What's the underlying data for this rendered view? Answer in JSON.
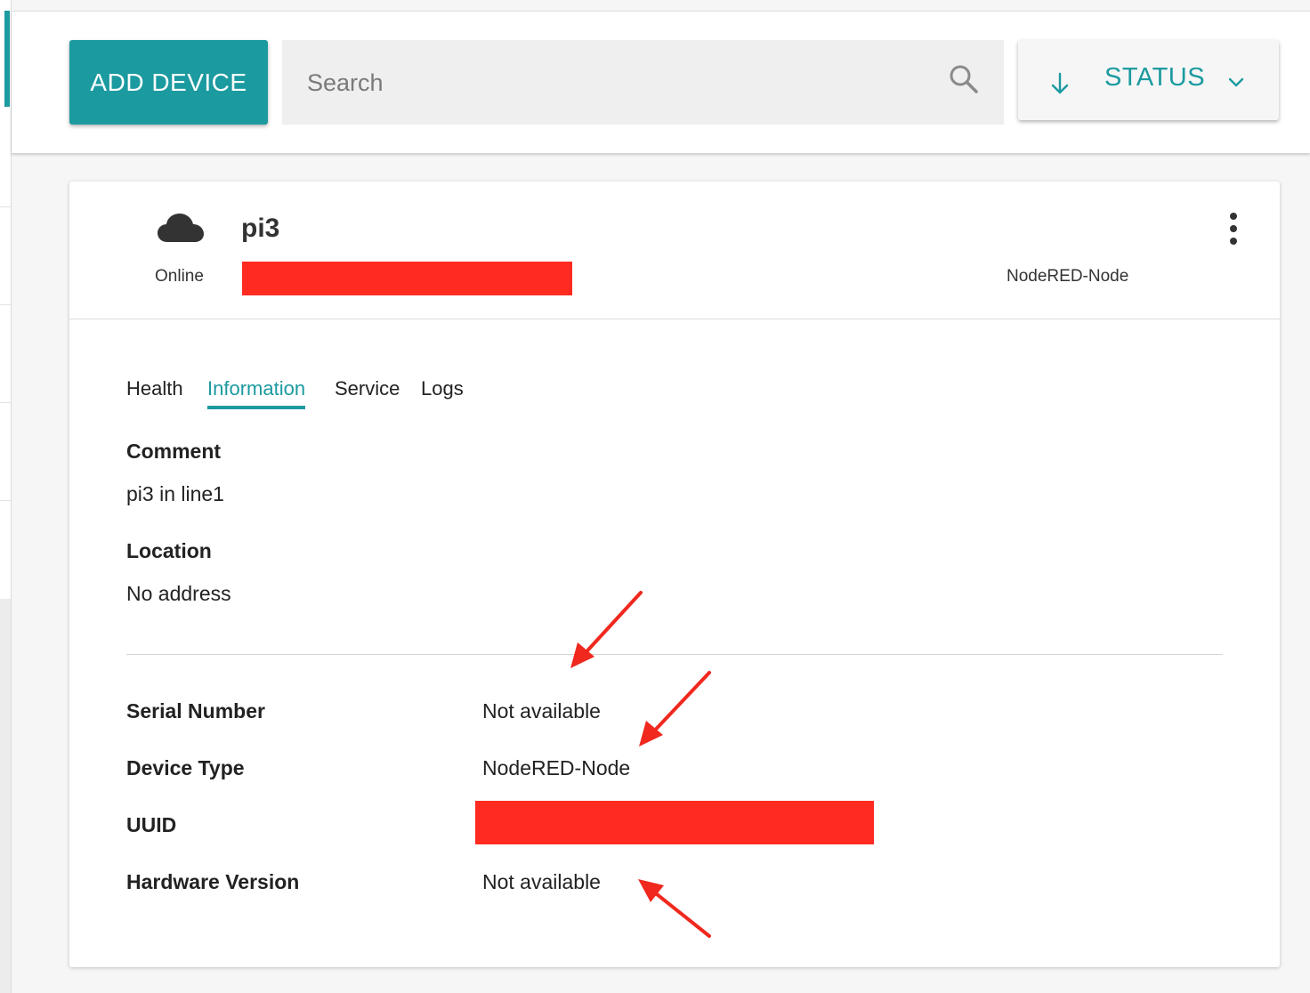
{
  "toolbar": {
    "add_device_label": "ADD DEVICE",
    "search_placeholder": "Search",
    "search_value": "",
    "status_label": "STATUS"
  },
  "device": {
    "name": "pi3",
    "status": "Online",
    "type": "NodeRED-Node"
  },
  "tabs": [
    {
      "label": "Health",
      "active": false
    },
    {
      "label": "Information",
      "active": true
    },
    {
      "label": "Service",
      "active": false
    },
    {
      "label": "Logs",
      "active": false
    }
  ],
  "information": {
    "comment_label": "Comment",
    "comment_value": "pi3 in line1",
    "location_label": "Location",
    "location_value": "No address",
    "rows": [
      {
        "label": "Serial Number",
        "value": "Not available"
      },
      {
        "label": "Device Type",
        "value": "NodeRED-Node"
      },
      {
        "label": "UUID",
        "value": ""
      },
      {
        "label": "Hardware Version",
        "value": "Not available"
      }
    ]
  },
  "colors": {
    "accent": "#1b9aa0",
    "redaction": "#ff2b20",
    "annotation": "#f0281e"
  },
  "icons": {
    "search": "search-icon",
    "sort": "arrow-down-icon",
    "dropdown": "chevron-down-icon",
    "device_status": "cloud-icon",
    "more": "more-vertical-icon"
  }
}
